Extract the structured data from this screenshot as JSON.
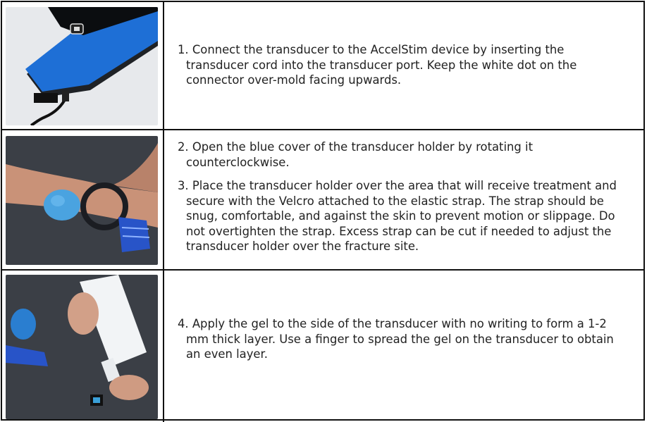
{
  "steps": [
    {
      "text": "1. Connect the transducer to the AccelStim device by inserting the transducer cord into the transducer port. Keep the white dot on the connector over-mold facing upwards."
    },
    {
      "text": "2. Open the blue cover of the transducer holder by rotating it counterclockwise."
    },
    {
      "text": "3. Place the transducer holder over the area that will receive treatment and secure with the Velcro attached to the elastic strap. The strap should be snug, comfortable, and against the skin to prevent motion or slippage. Do not overtighten the strap.  Excess strap can be cut if needed to adjust the transducer holder over the fracture site."
    },
    {
      "text": "4. Apply the gel to the side of the transducer with no writing to form a 1-2 mm thick layer. Use a finger to spread the gel on the transducer to obtain an even layer."
    }
  ],
  "colors": {
    "device_blue": "#1e6fd6",
    "strap_blue": "#2854c8",
    "shirt": "#3b3f46",
    "skin": "#c99278"
  }
}
